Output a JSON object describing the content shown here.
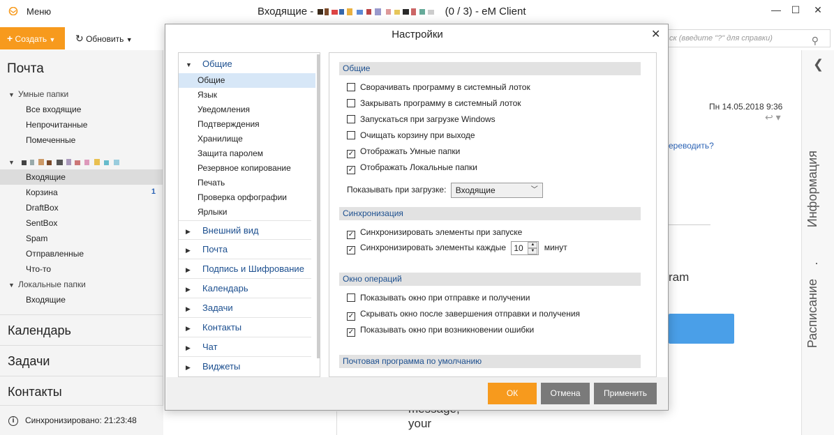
{
  "titlebar": {
    "menu_label": "Меню",
    "title_prefix": "Входящие -",
    "title_suffix": "(0 / 3) - eM Client",
    "window_controls": [
      "minimize-icon",
      "maximize-icon",
      "close-icon"
    ],
    "min_glyph": "—",
    "max_glyph": "☐",
    "close_glyph": "✕"
  },
  "toolbar": {
    "create_label": "Создать",
    "refresh_label": "Обновить",
    "search_placeholder": "ск (введите \"?\" для справки)"
  },
  "sidebar": {
    "header": "Почта",
    "smart_folders_label": "Умные папки",
    "smart_items": [
      "Все входящие",
      "Непрочитанные",
      "Помеченные"
    ],
    "account_items": [
      {
        "label": "Входящие",
        "count": ""
      },
      {
        "label": "Корзина",
        "count": "1"
      },
      {
        "label": "DraftBox",
        "count": ""
      },
      {
        "label": "SentBox",
        "count": ""
      },
      {
        "label": "Spam",
        "count": ""
      },
      {
        "label": "Отправленные",
        "count": ""
      },
      {
        "label": "Что-то",
        "count": ""
      }
    ],
    "local_folders_label": "Локальные папки",
    "local_items": [
      "Входящие"
    ],
    "sections": [
      "Календарь",
      "Задачи",
      "Контакты"
    ],
    "status_text": "Синхронизировано: 21:23:48"
  },
  "background": {
    "date": "Пн 14.05.2018 9:36",
    "link_fragment": "ереводить?",
    "fragment_ram": "ram",
    "fragment_message": "message,",
    "fragment_your": "your"
  },
  "right_panel": {
    "info_label": "Информация",
    "separator": "·",
    "schedule_label": "Расписание"
  },
  "dialog": {
    "title": "Настройки",
    "close_glyph": "✕",
    "nav": {
      "general": "Общие",
      "general_items": [
        "Общие",
        "Язык",
        "Уведомления",
        "Подтверждения",
        "Хранилище",
        "Защита паролем",
        "Резервное копирование",
        "Печать",
        "Проверка орфографии",
        "Ярлыки"
      ],
      "categories": [
        "Внешний вид",
        "Почта",
        "Подпись и Шифрование",
        "Календарь",
        "Задачи",
        "Контакты",
        "Чат",
        "Виджеты"
      ]
    },
    "groups": {
      "general": "Общие",
      "sync": "Синхронизация",
      "ops_window": "Окно операций",
      "default_mail": "Почтовая программа по умолчанию"
    },
    "general_options": [
      {
        "label": "Сворачивать программу в системный лоток",
        "checked": false
      },
      {
        "label": "Закрывать программу в системный лоток",
        "checked": false
      },
      {
        "label": "Запускаться при загрузке Windows",
        "checked": false
      },
      {
        "label": "Очищать корзину при выходе",
        "checked": false
      },
      {
        "label": "Отображать Умные папки",
        "checked": true
      },
      {
        "label": "Отображать Локальные папки",
        "checked": true
      }
    ],
    "startup_label": "Показывать при загрузке:",
    "startup_value": "Входящие",
    "sync_options": [
      {
        "label": "Синхронизировать элементы при запуске",
        "checked": true
      }
    ],
    "sync_every_label": "Синхронизировать элементы каждые",
    "sync_every_checked": true,
    "sync_every_value": "10",
    "sync_every_unit": "минут",
    "ops_options": [
      {
        "label": "Показывать окно при отправке и получении",
        "checked": false
      },
      {
        "label": "Скрывать окно после завершения отправки и получения",
        "checked": true
      },
      {
        "label": "Показывать окно при возникновении ошибки",
        "checked": true
      }
    ],
    "buttons": {
      "ok": "ОК",
      "cancel": "Отмена",
      "apply": "Применить"
    }
  },
  "colors": {
    "accent": "#f79a1d",
    "link": "#1c4f8f",
    "selected_nav": "#d7e7f7",
    "gray_button": "#7a7a7a"
  }
}
